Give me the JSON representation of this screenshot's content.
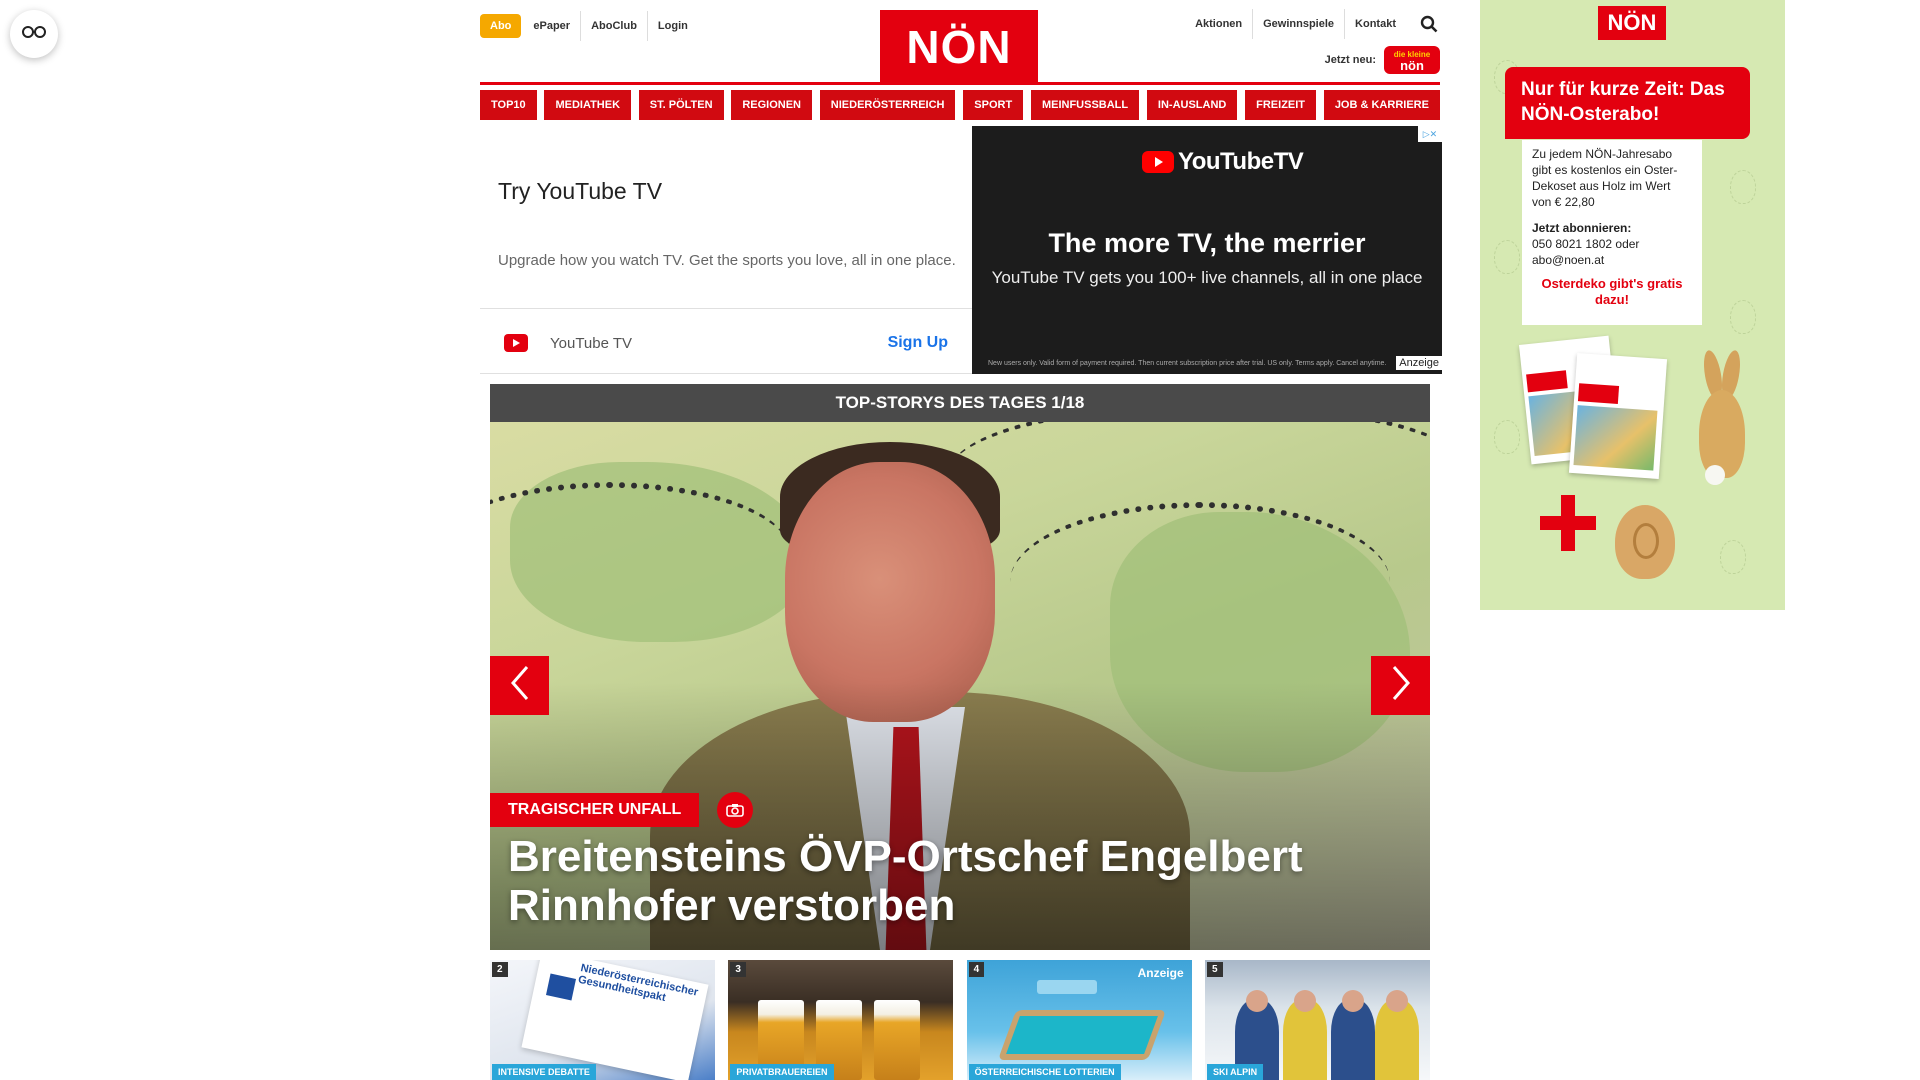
{
  "header": {
    "abo": "Abo",
    "left_links": [
      "ePaper",
      "AboClub",
      "Login"
    ],
    "logo": "NÖN",
    "right_links": [
      "Aktionen",
      "Gewinnspiele",
      "Kontakt"
    ],
    "jetzt_neu": "Jetzt neu:",
    "kids_badge_top": "die kleine",
    "kids_badge_main": "nön"
  },
  "nav": [
    "TOP10",
    "MEDIATHEK",
    "ST. PÖLTEN",
    "REGIONEN",
    "NIEDERÖSTERREICH",
    "SPORT",
    "MEINFUSSBALL",
    "IN-AUSLAND",
    "FREIZEIT",
    "JOB & KARRIERE"
  ],
  "ad": {
    "title": "Try YouTube TV",
    "description": "Upgrade how you watch TV. Get the sports you love, all in one place.",
    "brand": "YouTube TV",
    "cta": "Sign Up",
    "logo_text": "YouTubeTV",
    "headline": "The more TV, the merrier",
    "subline": "YouTube TV gets you 100+ live channels, all in one place",
    "fine_print": "New users only. Valid form of payment required. Then current subscription price after trial. US only. Terms apply. Cancel anytime.",
    "anzeige": "Anzeige"
  },
  "stories": {
    "bar_title": "TOP-STORYS DES TAGES 1/18",
    "tag": "TRAGISCHER UNFALL",
    "headline": "Breitensteins ÖVP-Ortschef Engelbert Rinnhofer verstorben"
  },
  "thumbs": [
    {
      "num": "2",
      "category": "INTENSIVE DEBATTE",
      "doc_text": "Niederösterreichischer Gesundheitspakt"
    },
    {
      "num": "3",
      "category": "PRIVATBRAUEREIEN"
    },
    {
      "num": "4",
      "category": "ÖSTERREICHISCHE LOTTERIEN",
      "anzeige": "Anzeige"
    },
    {
      "num": "5",
      "category": "SKI ALPIN"
    }
  ],
  "side_ad": {
    "logo": "NÖN",
    "banner": "Nur für kurze Zeit: Das NÖN-Osterabo!",
    "body": "Zu jedem NÖN-Jahresabo gibt es kostenlos ein Oster-Dekoset aus Holz im Wert von € 22,80",
    "cta_title": "Jetzt abonnieren:",
    "cta_contact": "050 8021 1802 oder abo@noen.at",
    "osterdeko": "Osterdeko gibt's gratis dazu!"
  },
  "colors": {
    "brand_red": "#e3000f",
    "abo_orange": "#f5a800",
    "story_bar": "#4a4a4a",
    "thumb_category": "#2aa6d9",
    "side_bg": "#d6e9b2"
  }
}
